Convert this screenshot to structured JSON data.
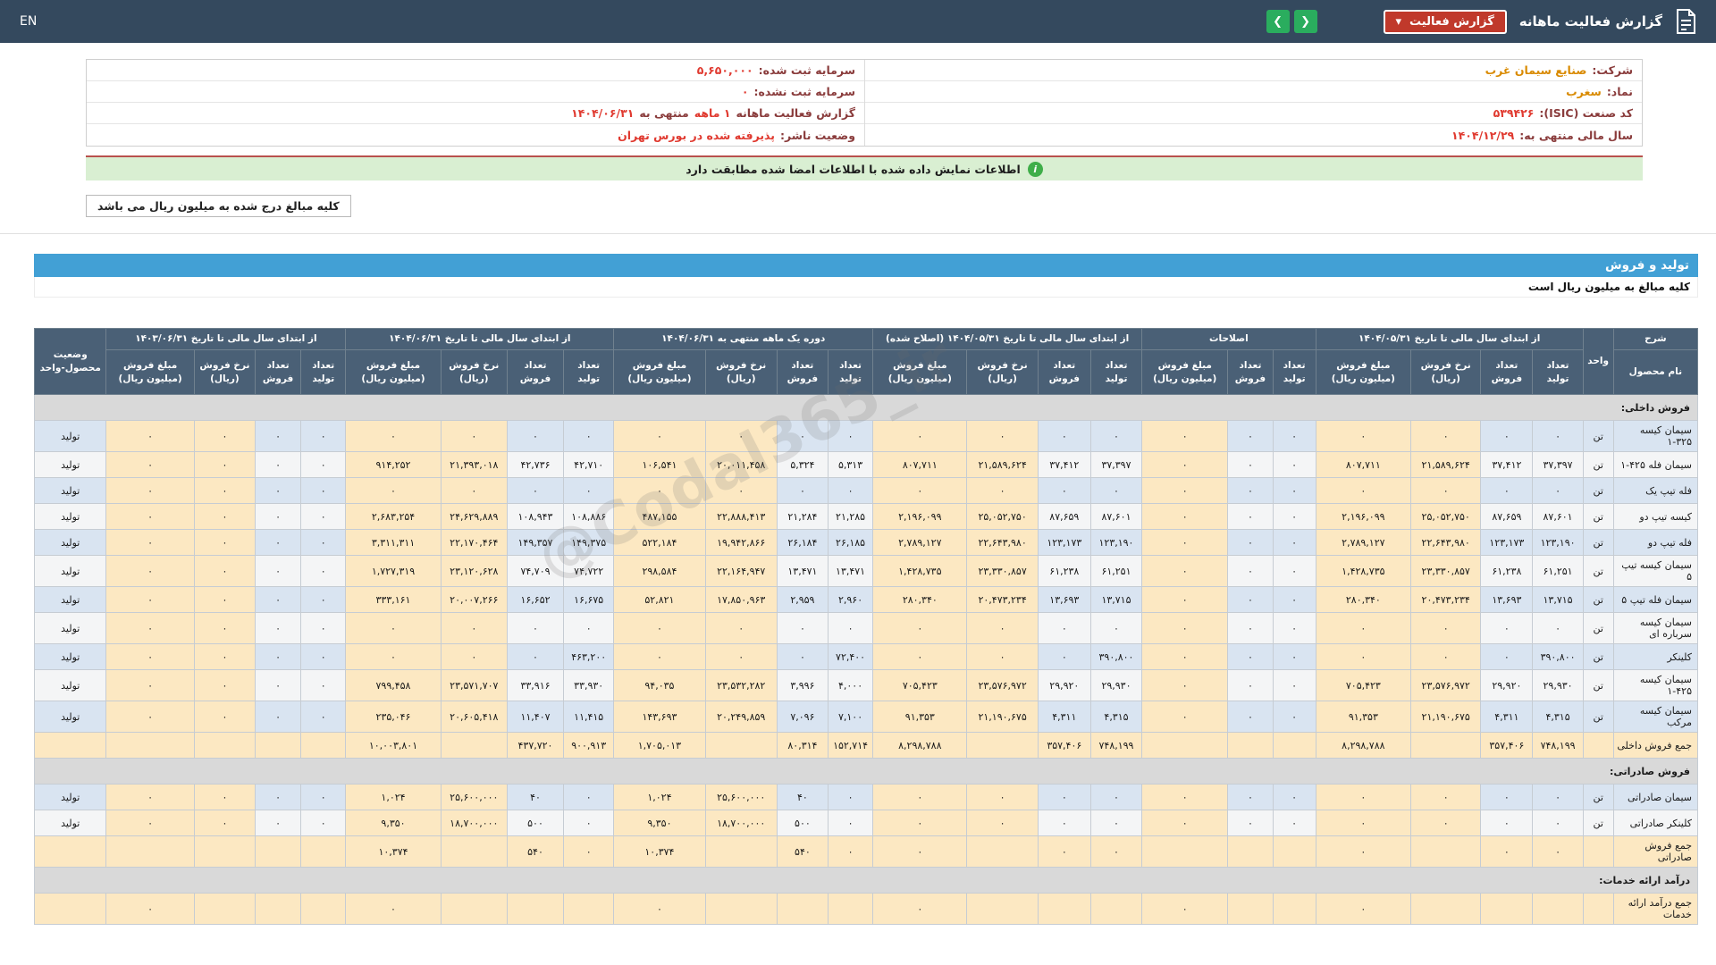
{
  "navbar": {
    "title": "گزارش فعالیت ماهانه",
    "dropdown": "گزارش فعالیت",
    "caret": "▾",
    "arrow_left": "❮",
    "arrow_right": "❯",
    "en": "EN"
  },
  "company": {
    "columns": [
      {
        "rows": [
          {
            "segments": [
              {
                "text": "شرکت:",
                "style": "label"
              },
              {
                "text": "صنایع سیمان غرب",
                "style": "link"
              }
            ]
          },
          {
            "segments": [
              {
                "text": "نماد:",
                "style": "label"
              },
              {
                "text": "سغرب",
                "style": "link"
              }
            ]
          },
          {
            "segments": [
              {
                "text": "کد صنعت (ISIC):",
                "style": "label"
              },
              {
                "text": "۵۳۹۴۲۶",
                "style": "red"
              }
            ]
          },
          {
            "segments": [
              {
                "text": "سال مالی منتهی به:",
                "style": "label"
              },
              {
                "text": "۱۴۰۴/۱۲/۲۹",
                "style": "red"
              }
            ]
          }
        ]
      },
      {
        "rows": [
          {
            "segments": [
              {
                "text": "سرمایه ثبت شده:",
                "style": "label"
              },
              {
                "text": "۵,۶۵۰,۰۰۰",
                "style": "red"
              }
            ]
          },
          {
            "segments": [
              {
                "text": "سرمایه ثبت نشده:",
                "style": "label"
              },
              {
                "text": "۰",
                "style": "red"
              }
            ]
          },
          {
            "segments": [
              {
                "text": "گزارش فعالیت ماهانه",
                "style": "label"
              },
              {
                "text": "۱ ماهه",
                "style": "red"
              },
              {
                "text": "منتهی به",
                "style": "label"
              },
              {
                "text": "۱۴۰۴/۰۶/۳۱",
                "style": "red"
              }
            ]
          },
          {
            "segments": [
              {
                "text": "وضعیت ناشر:",
                "style": "label"
              },
              {
                "text": "پذیرفته شده در بورس تهران",
                "style": "red"
              }
            ]
          }
        ]
      }
    ]
  },
  "notice": {
    "icon_glyph": "i",
    "text": "اطلاعات نمایش داده شده با اطلاعات امضا شده مطابقت دارد"
  },
  "amounts_note": "کلیه مبالغ درج شده به میلیون ریال می باشد",
  "section": {
    "title": "تولید و فروش",
    "note": "کلیه مبالغ به میلیون ریال است"
  },
  "watermark": "@Codal365_ir",
  "theme": {
    "navbar": "#34495e",
    "red": "#c0392b",
    "green": "#2aad5e",
    "label": "#8a3c3c",
    "valred": "#e03a30",
    "link": "#d98a00",
    "noticebg": "#d9efd2",
    "noticeicon": "#3fae49",
    "sectionbar": "#42a0d5",
    "thbg": "#4a6076",
    "rowblue": "#d9e4f1",
    "rowwhite": "#f4f5f6",
    "cream": "#fce8c2",
    "secgray": "#d9d9d9"
  },
  "table": {
    "header": {
      "sharh": "شرح",
      "product": "نام محصول",
      "unit": "واحد",
      "status": "وضعیت محصول-واحد",
      "groups": [
        {
          "label": "از ابتدای سال مالی تا تاریخ ۱۴۰۴/۰۵/۳۱",
          "cols": [
            "تعداد تولید",
            "تعداد فروش",
            "نرخ فروش (ریال)",
            "مبلغ فروش (میلیون ریال)"
          ]
        },
        {
          "label": "اصلاحات",
          "cols": [
            "تعداد تولید",
            "تعداد فروش",
            "مبلغ فروش (میلیون ریال)"
          ]
        },
        {
          "label": "از ابتدای سال مالی تا تاریخ ۱۴۰۴/۰۵/۳۱ (اصلاح شده)",
          "cols": [
            "تعداد تولید",
            "تعداد فروش",
            "نرخ فروش (ریال)",
            "مبلغ فروش (میلیون ریال)"
          ]
        },
        {
          "label": "دوره یک ماهه منتهی به ۱۴۰۴/۰۶/۳۱",
          "cols": [
            "تعداد تولید",
            "تعداد فروش",
            "نرخ فروش (ریال)",
            "مبلغ فروش (میلیون ریال)"
          ]
        },
        {
          "label": "از ابتدای سال مالی تا تاریخ ۱۴۰۴/۰۶/۳۱",
          "cols": [
            "تعداد تولید",
            "تعداد فروش",
            "نرخ فروش (ریال)",
            "مبلغ فروش (میلیون ریال)"
          ]
        },
        {
          "label": "از ابتدای سال مالی تا تاریخ ۱۴۰۳/۰۶/۳۱",
          "cols": [
            "تعداد تولید",
            "تعداد فروش",
            "نرخ فروش (ریال)",
            "مبلغ فروش (میلیون ریال)"
          ]
        }
      ]
    },
    "rows": [
      {
        "type": "section",
        "name": "فروش داخلی:"
      },
      {
        "type": "data",
        "shade": "blue",
        "name": "سیمان کیسه ۳۲۵-۱",
        "unit": "تن",
        "status": "تولید",
        "values": [
          [
            "۰",
            "۰",
            "۰",
            "۰"
          ],
          [
            "۰",
            "۰",
            "۰"
          ],
          [
            "۰",
            "۰",
            "۰",
            "۰"
          ],
          [
            "۰",
            "۰",
            "۰",
            "۰"
          ],
          [
            "۰",
            "۰",
            "۰",
            "۰"
          ],
          [
            "۰",
            "۰",
            "۰",
            "۰"
          ]
        ]
      },
      {
        "type": "data",
        "shade": "white",
        "name": "سیمان فله ۴۲۵-۱",
        "unit": "تن",
        "status": "تولید",
        "values": [
          [
            "۳۷,۳۹۷",
            "۳۷,۴۱۲",
            "۲۱,۵۸۹,۶۲۴",
            "۸۰۷,۷۱۱"
          ],
          [
            "۰",
            "۰",
            "۰"
          ],
          [
            "۳۷,۳۹۷",
            "۳۷,۴۱۲",
            "۲۱,۵۸۹,۶۲۴",
            "۸۰۷,۷۱۱"
          ],
          [
            "۵,۳۱۳",
            "۵,۳۲۴",
            "۲۰,۰۱۱,۴۵۸",
            "۱۰۶,۵۴۱"
          ],
          [
            "۴۲,۷۱۰",
            "۴۲,۷۳۶",
            "۲۱,۳۹۳,۰۱۸",
            "۹۱۴,۲۵۲"
          ],
          [
            "۰",
            "۰",
            "۰",
            "۰"
          ]
        ]
      },
      {
        "type": "data",
        "shade": "blue",
        "name": "فله تیپ یک",
        "unit": "تن",
        "status": "تولید",
        "values": [
          [
            "۰",
            "۰",
            "۰",
            "۰"
          ],
          [
            "۰",
            "۰",
            "۰"
          ],
          [
            "۰",
            "۰",
            "۰",
            "۰"
          ],
          [
            "۰",
            "۰",
            "۰",
            "۰"
          ],
          [
            "۰",
            "۰",
            "۰",
            "۰"
          ],
          [
            "۰",
            "۰",
            "۰",
            "۰"
          ]
        ]
      },
      {
        "type": "data",
        "shade": "white",
        "name": "کیسه تیپ دو",
        "unit": "تن",
        "status": "تولید",
        "values": [
          [
            "۸۷,۶۰۱",
            "۸۷,۶۵۹",
            "۲۵,۰۵۲,۷۵۰",
            "۲,۱۹۶,۰۹۹"
          ],
          [
            "۰",
            "۰",
            "۰"
          ],
          [
            "۸۷,۶۰۱",
            "۸۷,۶۵۹",
            "۲۵,۰۵۲,۷۵۰",
            "۲,۱۹۶,۰۹۹"
          ],
          [
            "۲۱,۲۸۵",
            "۲۱,۲۸۴",
            "۲۲,۸۸۸,۴۱۳",
            "۴۸۷,۱۵۵"
          ],
          [
            "۱۰۸,۸۸۶",
            "۱۰۸,۹۴۳",
            "۲۴,۶۲۹,۸۸۹",
            "۲,۶۸۳,۲۵۴"
          ],
          [
            "۰",
            "۰",
            "۰",
            "۰"
          ]
        ]
      },
      {
        "type": "data",
        "shade": "blue",
        "name": "فله تیپ دو",
        "unit": "تن",
        "status": "تولید",
        "values": [
          [
            "۱۲۳,۱۹۰",
            "۱۲۳,۱۷۳",
            "۲۲,۶۴۳,۹۸۰",
            "۲,۷۸۹,۱۲۷"
          ],
          [
            "۰",
            "۰",
            "۰"
          ],
          [
            "۱۲۳,۱۹۰",
            "۱۲۳,۱۷۳",
            "۲۲,۶۴۳,۹۸۰",
            "۲,۷۸۹,۱۲۷"
          ],
          [
            "۲۶,۱۸۵",
            "۲۶,۱۸۴",
            "۱۹,۹۴۲,۸۶۶",
            "۵۲۲,۱۸۴"
          ],
          [
            "۱۴۹,۳۷۵",
            "۱۴۹,۳۵۷",
            "۲۲,۱۷۰,۴۶۴",
            "۳,۳۱۱,۳۱۱"
          ],
          [
            "۰",
            "۰",
            "۰",
            "۰"
          ]
        ]
      },
      {
        "type": "data",
        "shade": "white",
        "name": "سیمان کیسه تیپ ۵",
        "unit": "تن",
        "status": "تولید",
        "values": [
          [
            "۶۱,۲۵۱",
            "۶۱,۲۳۸",
            "۲۳,۳۳۰,۸۵۷",
            "۱,۴۲۸,۷۳۵"
          ],
          [
            "۰",
            "۰",
            "۰"
          ],
          [
            "۶۱,۲۵۱",
            "۶۱,۲۳۸",
            "۲۳,۳۳۰,۸۵۷",
            "۱,۴۲۸,۷۳۵"
          ],
          [
            "۱۳,۴۷۱",
            "۱۳,۴۷۱",
            "۲۲,۱۶۴,۹۴۷",
            "۲۹۸,۵۸۴"
          ],
          [
            "۷۴,۷۲۲",
            "۷۴,۷۰۹",
            "۲۳,۱۲۰,۶۲۸",
            "۱,۷۲۷,۳۱۹"
          ],
          [
            "۰",
            "۰",
            "۰",
            "۰"
          ]
        ]
      },
      {
        "type": "data",
        "shade": "blue",
        "name": "سیمان فله تیپ ۵",
        "unit": "تن",
        "status": "تولید",
        "values": [
          [
            "۱۳,۷۱۵",
            "۱۳,۶۹۳",
            "۲۰,۴۷۳,۲۳۴",
            "۲۸۰,۳۴۰"
          ],
          [
            "۰",
            "۰",
            "۰"
          ],
          [
            "۱۳,۷۱۵",
            "۱۳,۶۹۳",
            "۲۰,۴۷۳,۲۳۴",
            "۲۸۰,۳۴۰"
          ],
          [
            "۲,۹۶۰",
            "۲,۹۵۹",
            "۱۷,۸۵۰,۹۶۳",
            "۵۲,۸۲۱"
          ],
          [
            "۱۶,۶۷۵",
            "۱۶,۶۵۲",
            "۲۰,۰۰۷,۲۶۶",
            "۳۳۳,۱۶۱"
          ],
          [
            "۰",
            "۰",
            "۰",
            "۰"
          ]
        ]
      },
      {
        "type": "data",
        "shade": "white",
        "name": "سیمان کیسه سرباره ای",
        "unit": "تن",
        "status": "تولید",
        "values": [
          [
            "۰",
            "۰",
            "۰",
            "۰"
          ],
          [
            "۰",
            "۰",
            "۰"
          ],
          [
            "۰",
            "۰",
            "۰",
            "۰"
          ],
          [
            "۰",
            "۰",
            "۰",
            "۰"
          ],
          [
            "۰",
            "۰",
            "۰",
            "۰"
          ],
          [
            "۰",
            "۰",
            "۰",
            "۰"
          ]
        ]
      },
      {
        "type": "data",
        "shade": "blue",
        "name": "کلینکر",
        "unit": "تن",
        "status": "تولید",
        "values": [
          [
            "۳۹۰,۸۰۰",
            "۰",
            "۰",
            "۰"
          ],
          [
            "۰",
            "۰",
            "۰"
          ],
          [
            "۳۹۰,۸۰۰",
            "۰",
            "۰",
            "۰"
          ],
          [
            "۷۲,۴۰۰",
            "۰",
            "۰",
            "۰"
          ],
          [
            "۴۶۳,۲۰۰",
            "۰",
            "۰",
            "۰"
          ],
          [
            "۰",
            "۰",
            "۰",
            "۰"
          ]
        ]
      },
      {
        "type": "data",
        "shade": "white",
        "name": "سیمان کیسه ۴۲۵-۱",
        "unit": "تن",
        "status": "تولید",
        "values": [
          [
            "۲۹,۹۳۰",
            "۲۹,۹۲۰",
            "۲۳,۵۷۶,۹۷۲",
            "۷۰۵,۴۲۳"
          ],
          [
            "۰",
            "۰",
            "۰"
          ],
          [
            "۲۹,۹۳۰",
            "۲۹,۹۲۰",
            "۲۳,۵۷۶,۹۷۲",
            "۷۰۵,۴۲۳"
          ],
          [
            "۴,۰۰۰",
            "۳,۹۹۶",
            "۲۳,۵۳۲,۲۸۲",
            "۹۴,۰۳۵"
          ],
          [
            "۳۳,۹۳۰",
            "۳۳,۹۱۶",
            "۲۳,۵۷۱,۷۰۷",
            "۷۹۹,۴۵۸"
          ],
          [
            "۰",
            "۰",
            "۰",
            "۰"
          ]
        ]
      },
      {
        "type": "data",
        "shade": "blue",
        "name": "سیمان کیسه مرکب",
        "unit": "تن",
        "status": "تولید",
        "values": [
          [
            "۴,۳۱۵",
            "۴,۳۱۱",
            "۲۱,۱۹۰,۶۷۵",
            "۹۱,۳۵۳"
          ],
          [
            "۰",
            "۰",
            "۰"
          ],
          [
            "۴,۳۱۵",
            "۴,۳۱۱",
            "۲۱,۱۹۰,۶۷۵",
            "۹۱,۳۵۳"
          ],
          [
            "۷,۱۰۰",
            "۷,۰۹۶",
            "۲۰,۲۴۹,۸۵۹",
            "۱۴۳,۶۹۳"
          ],
          [
            "۱۱,۴۱۵",
            "۱۱,۴۰۷",
            "۲۰,۶۰۵,۴۱۸",
            "۲۳۵,۰۴۶"
          ],
          [
            "۰",
            "۰",
            "۰",
            "۰"
          ]
        ]
      },
      {
        "type": "total",
        "name": "جمع فروش داخلی",
        "unit": "",
        "status": "",
        "values": [
          [
            "۷۴۸,۱۹۹",
            "۳۵۷,۴۰۶",
            "",
            "۸,۲۹۸,۷۸۸"
          ],
          [
            "",
            "",
            ""
          ],
          [
            "۷۴۸,۱۹۹",
            "۳۵۷,۴۰۶",
            "",
            "۸,۲۹۸,۷۸۸"
          ],
          [
            "۱۵۲,۷۱۴",
            "۸۰,۳۱۴",
            "",
            "۱,۷۰۵,۰۱۳"
          ],
          [
            "۹۰۰,۹۱۳",
            "۴۳۷,۷۲۰",
            "",
            "۱۰,۰۰۳,۸۰۱"
          ],
          [
            "",
            "",
            "",
            ""
          ]
        ]
      },
      {
        "type": "section",
        "name": "فروش صادراتی:"
      },
      {
        "type": "data",
        "shade": "blue",
        "name": "سیمان صادراتی",
        "unit": "تن",
        "status": "تولید",
        "values": [
          [
            "۰",
            "۰",
            "۰",
            "۰"
          ],
          [
            "۰",
            "۰",
            "۰"
          ],
          [
            "۰",
            "۰",
            "۰",
            "۰"
          ],
          [
            "۰",
            "۴۰",
            "۲۵,۶۰۰,۰۰۰",
            "۱,۰۲۴"
          ],
          [
            "۰",
            "۴۰",
            "۲۵,۶۰۰,۰۰۰",
            "۱,۰۲۴"
          ],
          [
            "۰",
            "۰",
            "۰",
            "۰"
          ]
        ]
      },
      {
        "type": "data",
        "shade": "white",
        "name": "کلینکر صادراتی",
        "unit": "تن",
        "status": "تولید",
        "values": [
          [
            "۰",
            "۰",
            "۰",
            "۰"
          ],
          [
            "۰",
            "۰",
            "۰"
          ],
          [
            "۰",
            "۰",
            "۰",
            "۰"
          ],
          [
            "۰",
            "۵۰۰",
            "۱۸,۷۰۰,۰۰۰",
            "۹,۳۵۰"
          ],
          [
            "۰",
            "۵۰۰",
            "۱۸,۷۰۰,۰۰۰",
            "۹,۳۵۰"
          ],
          [
            "۰",
            "۰",
            "۰",
            "۰"
          ]
        ]
      },
      {
        "type": "total",
        "name": "جمع فروش صادراتی",
        "unit": "",
        "status": "",
        "values": [
          [
            "۰",
            "۰",
            "",
            "۰"
          ],
          [
            "",
            "",
            ""
          ],
          [
            "۰",
            "۰",
            "",
            "۰"
          ],
          [
            "۰",
            "۵۴۰",
            "",
            "۱۰,۳۷۴"
          ],
          [
            "۰",
            "۵۴۰",
            "",
            "۱۰,۳۷۴"
          ],
          [
            "",
            "",
            "",
            ""
          ]
        ]
      },
      {
        "type": "section",
        "name": "درآمد ارائه خدمات:"
      },
      {
        "type": "total",
        "name": "جمع درآمد ارائه خدمات",
        "unit": "",
        "status": "",
        "values": [
          [
            "",
            "",
            "",
            "۰"
          ],
          [
            "",
            "",
            "۰"
          ],
          [
            "",
            "",
            "",
            "۰"
          ],
          [
            "",
            "",
            "",
            "۰"
          ],
          [
            "",
            "",
            "",
            "۰"
          ],
          [
            "",
            "",
            "",
            "۰"
          ]
        ]
      }
    ]
  }
}
